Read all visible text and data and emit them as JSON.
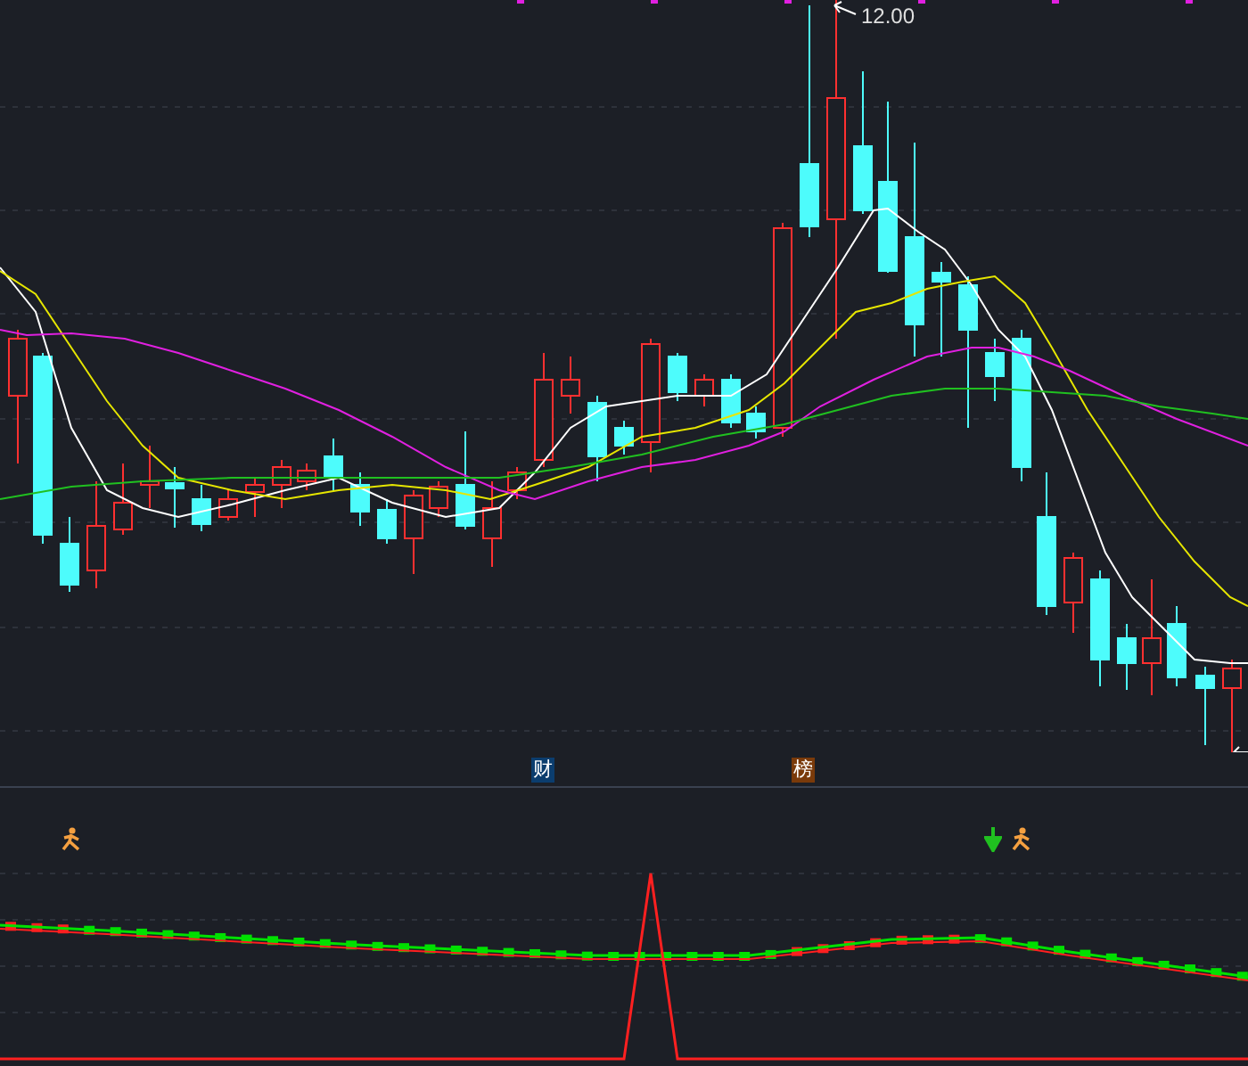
{
  "price_chart": {
    "high_label": "12.00"
  },
  "event_markers": [
    {
      "label": "财",
      "color": "#0b3d6e"
    },
    {
      "label": "榜",
      "color": "#7a3a0a"
    }
  ],
  "indicator_panel": {
    "signals": [
      {
        "kind": "person"
      },
      {
        "kind": "arrow_down"
      },
      {
        "kind": "person"
      }
    ]
  }
}
